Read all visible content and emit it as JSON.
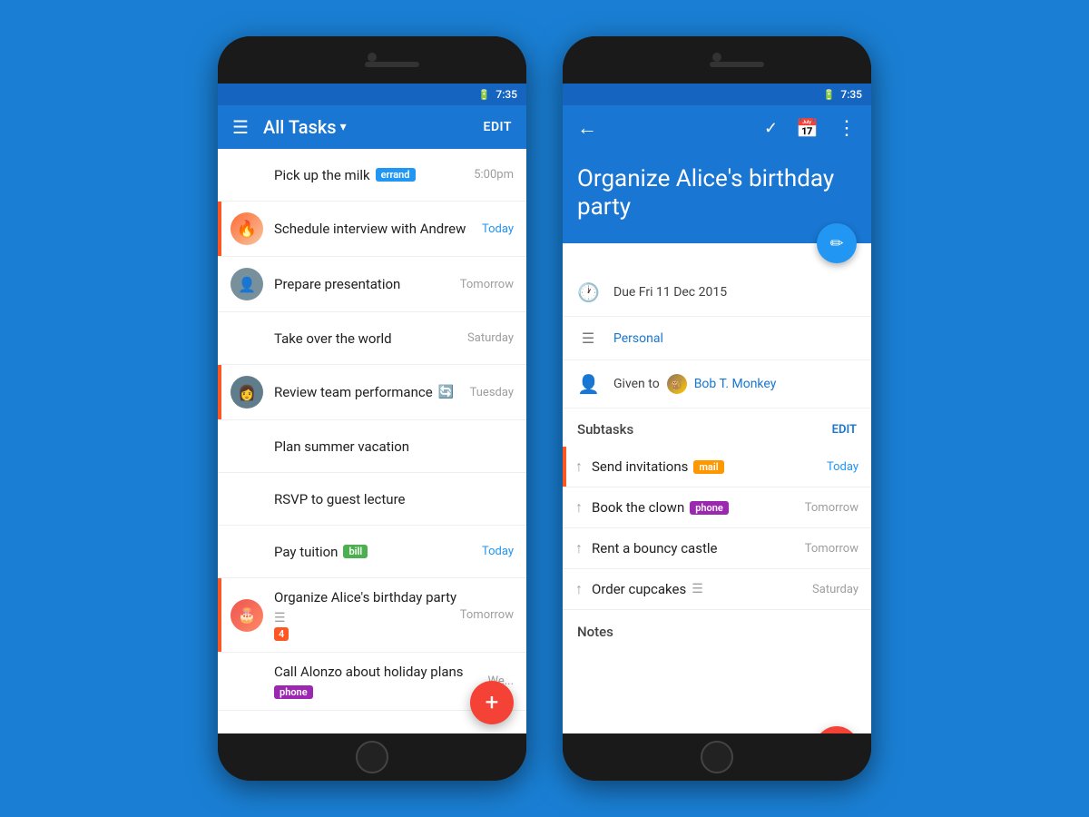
{
  "background_color": "#1a7fd4",
  "status_bar": {
    "time": "7:35",
    "battery_icon": "🔋"
  },
  "phone_left": {
    "header": {
      "title": "All Tasks",
      "dropdown_indicator": "▾",
      "edit_label": "EDIT"
    },
    "tasks": [
      {
        "id": "pick-up-milk",
        "title": "Pick up the milk",
        "badge": "errand",
        "badge_type": "errand",
        "due": "5:00pm",
        "due_type": "time",
        "has_avatar": false,
        "has_border": false
      },
      {
        "id": "schedule-interview",
        "title": "Schedule interview with Andrew",
        "badge": null,
        "due": "Today",
        "due_type": "today",
        "has_avatar": true,
        "avatar_type": "fire",
        "has_border": true
      },
      {
        "id": "prepare-presentation",
        "title": "Prepare presentation",
        "badge": null,
        "due": "Tomorrow",
        "due_type": "future",
        "has_avatar": true,
        "avatar_type": "person",
        "has_border": false
      },
      {
        "id": "take-over-world",
        "title": "Take over the world",
        "badge": null,
        "due": "Saturday",
        "due_type": "future",
        "has_avatar": false,
        "has_border": false
      },
      {
        "id": "review-team",
        "title": "Review team performance",
        "has_repeat": true,
        "badge": null,
        "due": "Tuesday",
        "due_type": "future",
        "has_avatar": true,
        "avatar_type": "person2",
        "has_border": true
      },
      {
        "id": "plan-vacation",
        "title": "Plan summer vacation",
        "badge": null,
        "due": "",
        "due_type": "none",
        "has_avatar": false,
        "has_border": false
      },
      {
        "id": "rsvp-lecture",
        "title": "RSVP to guest lecture",
        "badge": null,
        "due": "",
        "due_type": "none",
        "has_avatar": false,
        "has_border": false
      },
      {
        "id": "pay-tuition",
        "title": "Pay tuition",
        "badge": "bill",
        "badge_type": "bill",
        "due": "Today",
        "due_type": "today",
        "has_avatar": false,
        "has_border": false
      },
      {
        "id": "organize-birthday",
        "title": "Organize Alice's birthday party",
        "badge": null,
        "due": "Tomorrow",
        "due_type": "future",
        "has_avatar": true,
        "avatar_type": "alice",
        "has_notes": true,
        "subtask_count": "4",
        "has_border": true
      },
      {
        "id": "call-alonzo",
        "title": "Call Alonzo about holiday plans",
        "badge": "phone",
        "badge_type": "phone",
        "due": "We...",
        "due_type": "future",
        "has_avatar": false,
        "has_border": false
      }
    ],
    "fab_label": "+"
  },
  "phone_right": {
    "header": {
      "back_icon": "←",
      "check_icon": "✓",
      "calendar_icon": "📅",
      "more_icon": "⋮"
    },
    "task_title": "Organize Alice's birthday party",
    "fab_edit_icon": "✏",
    "meta": {
      "due_icon": "🕐",
      "due_text": "Due Fri 11 Dec 2015",
      "list_icon": "☰",
      "list_text": "Personal",
      "person_icon": "👤",
      "given_to_prefix": "Given to",
      "assignee_name": "Bob T. Monkey"
    },
    "subtasks_section": {
      "label": "Subtasks",
      "edit_label": "EDIT",
      "items": [
        {
          "id": "send-invitations",
          "title": "Send invitations",
          "badge": "mail",
          "badge_type": "mail",
          "due": "Today",
          "due_type": "today",
          "active": true
        },
        {
          "id": "book-clown",
          "title": "Book the clown",
          "badge": "phone",
          "badge_type": "phone",
          "due": "Tomorrow",
          "due_type": "future",
          "active": false
        },
        {
          "id": "rent-bouncy",
          "title": "Rent a bouncy castle",
          "badge": null,
          "due": "Tomorrow",
          "due_type": "future",
          "active": false
        },
        {
          "id": "order-cupcakes",
          "title": "Order cupcakes",
          "badge": null,
          "has_notes": true,
          "due": "Saturday",
          "due_type": "future",
          "active": false
        }
      ]
    },
    "notes_section": {
      "label": "Notes"
    },
    "fab_label": "+"
  }
}
